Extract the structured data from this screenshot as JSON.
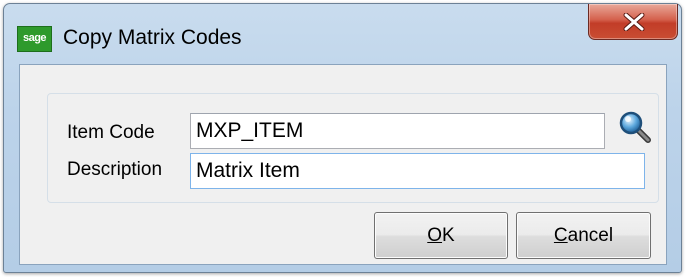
{
  "window": {
    "title": "Copy Matrix Codes",
    "app_icon_text": "sage",
    "app_icon_color": "#2e9a2c",
    "close_label": "x"
  },
  "form": {
    "item_code": {
      "label": "Item Code",
      "value": "MXP_ITEM"
    },
    "description": {
      "label": "Description",
      "value": "Matrix Item"
    }
  },
  "buttons": {
    "ok": {
      "mnemonic": "O",
      "rest": "K"
    },
    "cancel": {
      "mnemonic": "C",
      "rest": "ancel"
    }
  },
  "icons": {
    "lookup": "magnifier-icon",
    "close": "close-icon"
  },
  "colors": {
    "close_button": "#c94d33",
    "focus_border": "#7eb4ea"
  }
}
